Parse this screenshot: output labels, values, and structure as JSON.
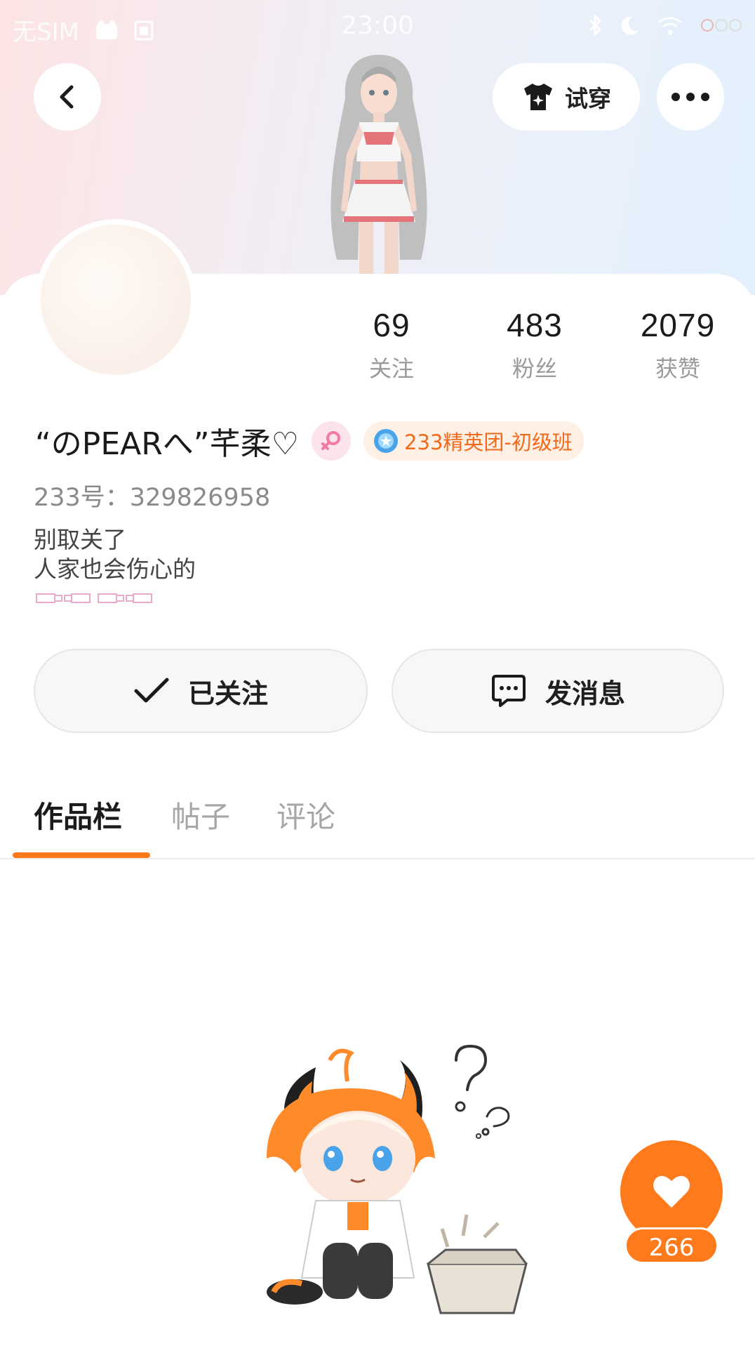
{
  "status_bar": {
    "carrier": "无SIM",
    "time": "23:00"
  },
  "header": {
    "tryon_label": "试穿"
  },
  "stats": [
    {
      "value": "69",
      "label": "关注"
    },
    {
      "value": "483",
      "label": "粉丝"
    },
    {
      "value": "2079",
      "label": "获赞"
    }
  ],
  "profile": {
    "name": "“のPEARへ”芊柔♡",
    "rank_badge": "233精英团-初级班",
    "user_id": "233号：329826958",
    "bio_line1": "别取关了",
    "bio_line2": "人家也会伤心的"
  },
  "actions": {
    "follow_label": "已关注",
    "message_label": "发消息"
  },
  "tabs": [
    {
      "label": "作品栏",
      "active": true
    },
    {
      "label": "帖子",
      "active": false
    },
    {
      "label": "评论",
      "active": false
    }
  ],
  "like": {
    "count": "266"
  },
  "colors": {
    "accent": "#ff7a1a",
    "badge_text": "#f26a1b",
    "gender_pink": "#f07aa0"
  }
}
